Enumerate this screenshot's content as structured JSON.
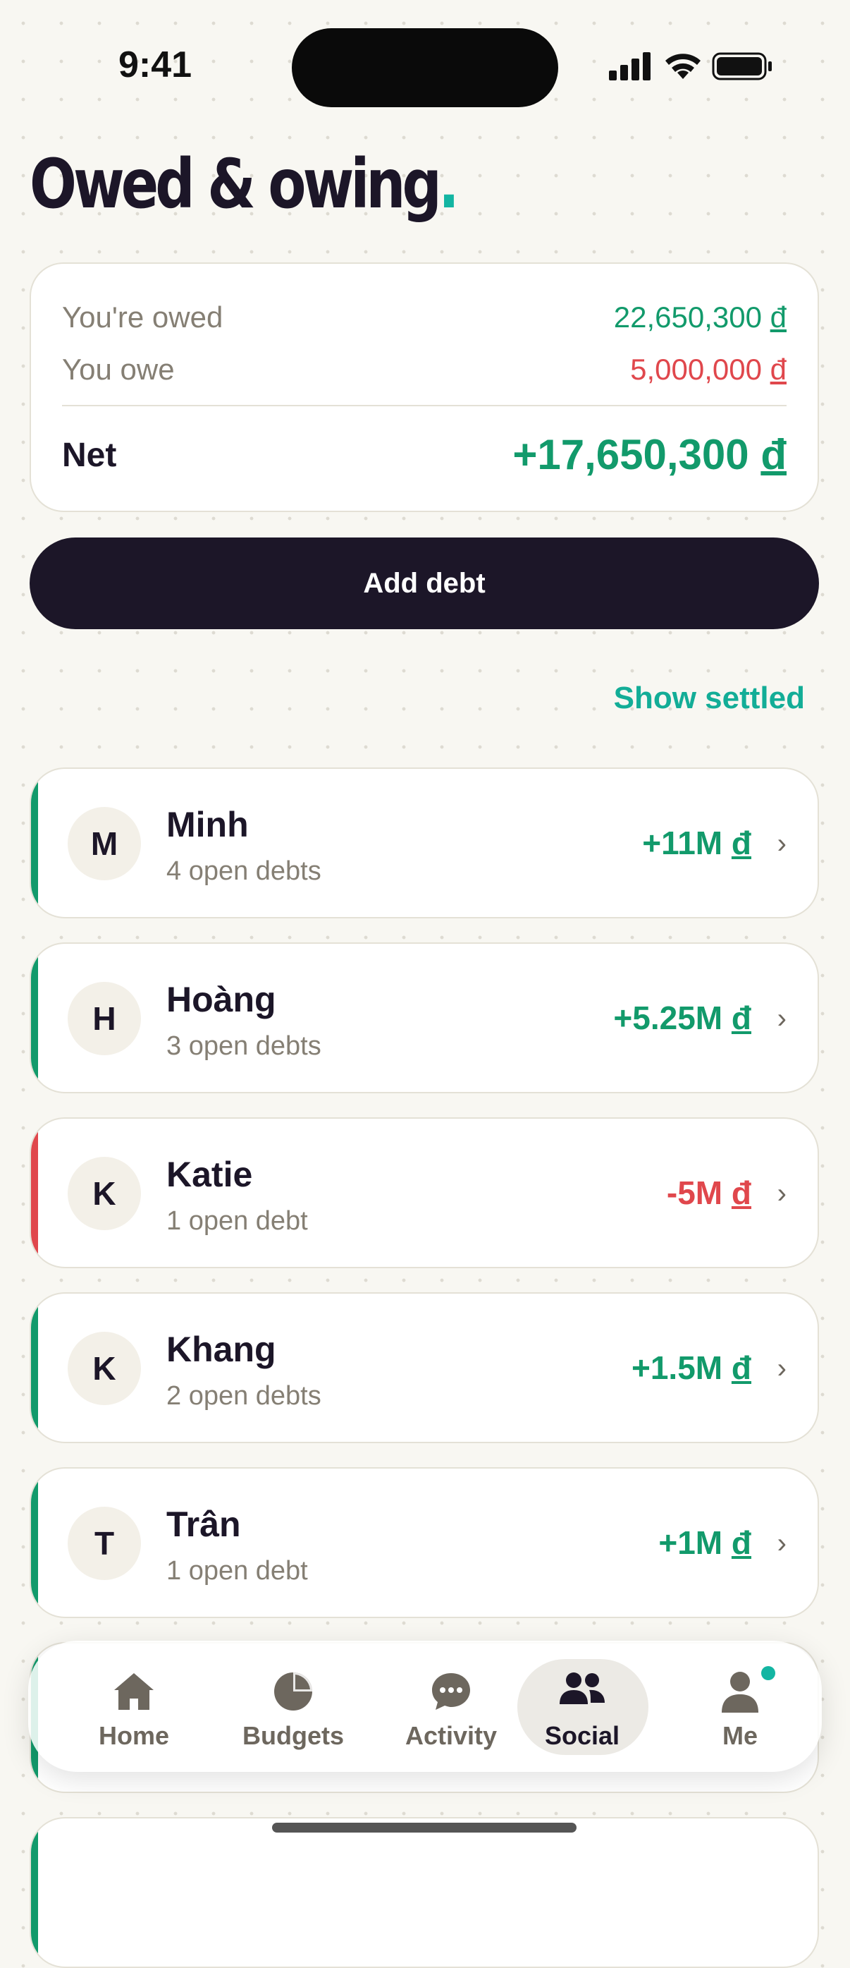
{
  "status_bar": {
    "time": "9:41"
  },
  "header": {
    "title": "Owed & owing",
    "title_dot": "."
  },
  "summary": {
    "owed_label": "You're owed",
    "owed_value": "22,650,300",
    "owe_label": "You owe",
    "owe_value": "5,000,000",
    "net_label": "Net",
    "net_value": "+17,650,300",
    "currency": "đ"
  },
  "actions": {
    "add_debt": "Add debt",
    "show_settled": "Show settled"
  },
  "people": [
    {
      "initial": "M",
      "name": "Minh",
      "subtitle": "4 open debts",
      "amount": "+11M",
      "direction": "positive"
    },
    {
      "initial": "H",
      "name": "Hoàng",
      "subtitle": "3 open debts",
      "amount": "+5.25M",
      "direction": "positive"
    },
    {
      "initial": "K",
      "name": "Katie",
      "subtitle": "1 open debt",
      "amount": "-5M",
      "direction": "negative"
    },
    {
      "initial": "K",
      "name": "Khang",
      "subtitle": "2 open debts",
      "amount": "+1.5M",
      "direction": "positive"
    },
    {
      "initial": "T",
      "name": "Trân",
      "subtitle": "1 open debt",
      "amount": "+1M",
      "direction": "positive"
    }
  ],
  "tabs": [
    {
      "label": "Home",
      "icon": "home-icon"
    },
    {
      "label": "Budgets",
      "icon": "pie-chart-icon"
    },
    {
      "label": "Activity",
      "icon": "chat-bubble-icon"
    },
    {
      "label": "Social",
      "icon": "people-icon",
      "active": true
    },
    {
      "label": "Me",
      "icon": "person-icon"
    }
  ],
  "colors": {
    "accent": "#13b5a2",
    "positive": "#129a6b",
    "negative": "#e0474c",
    "dark": "#1c1628"
  }
}
